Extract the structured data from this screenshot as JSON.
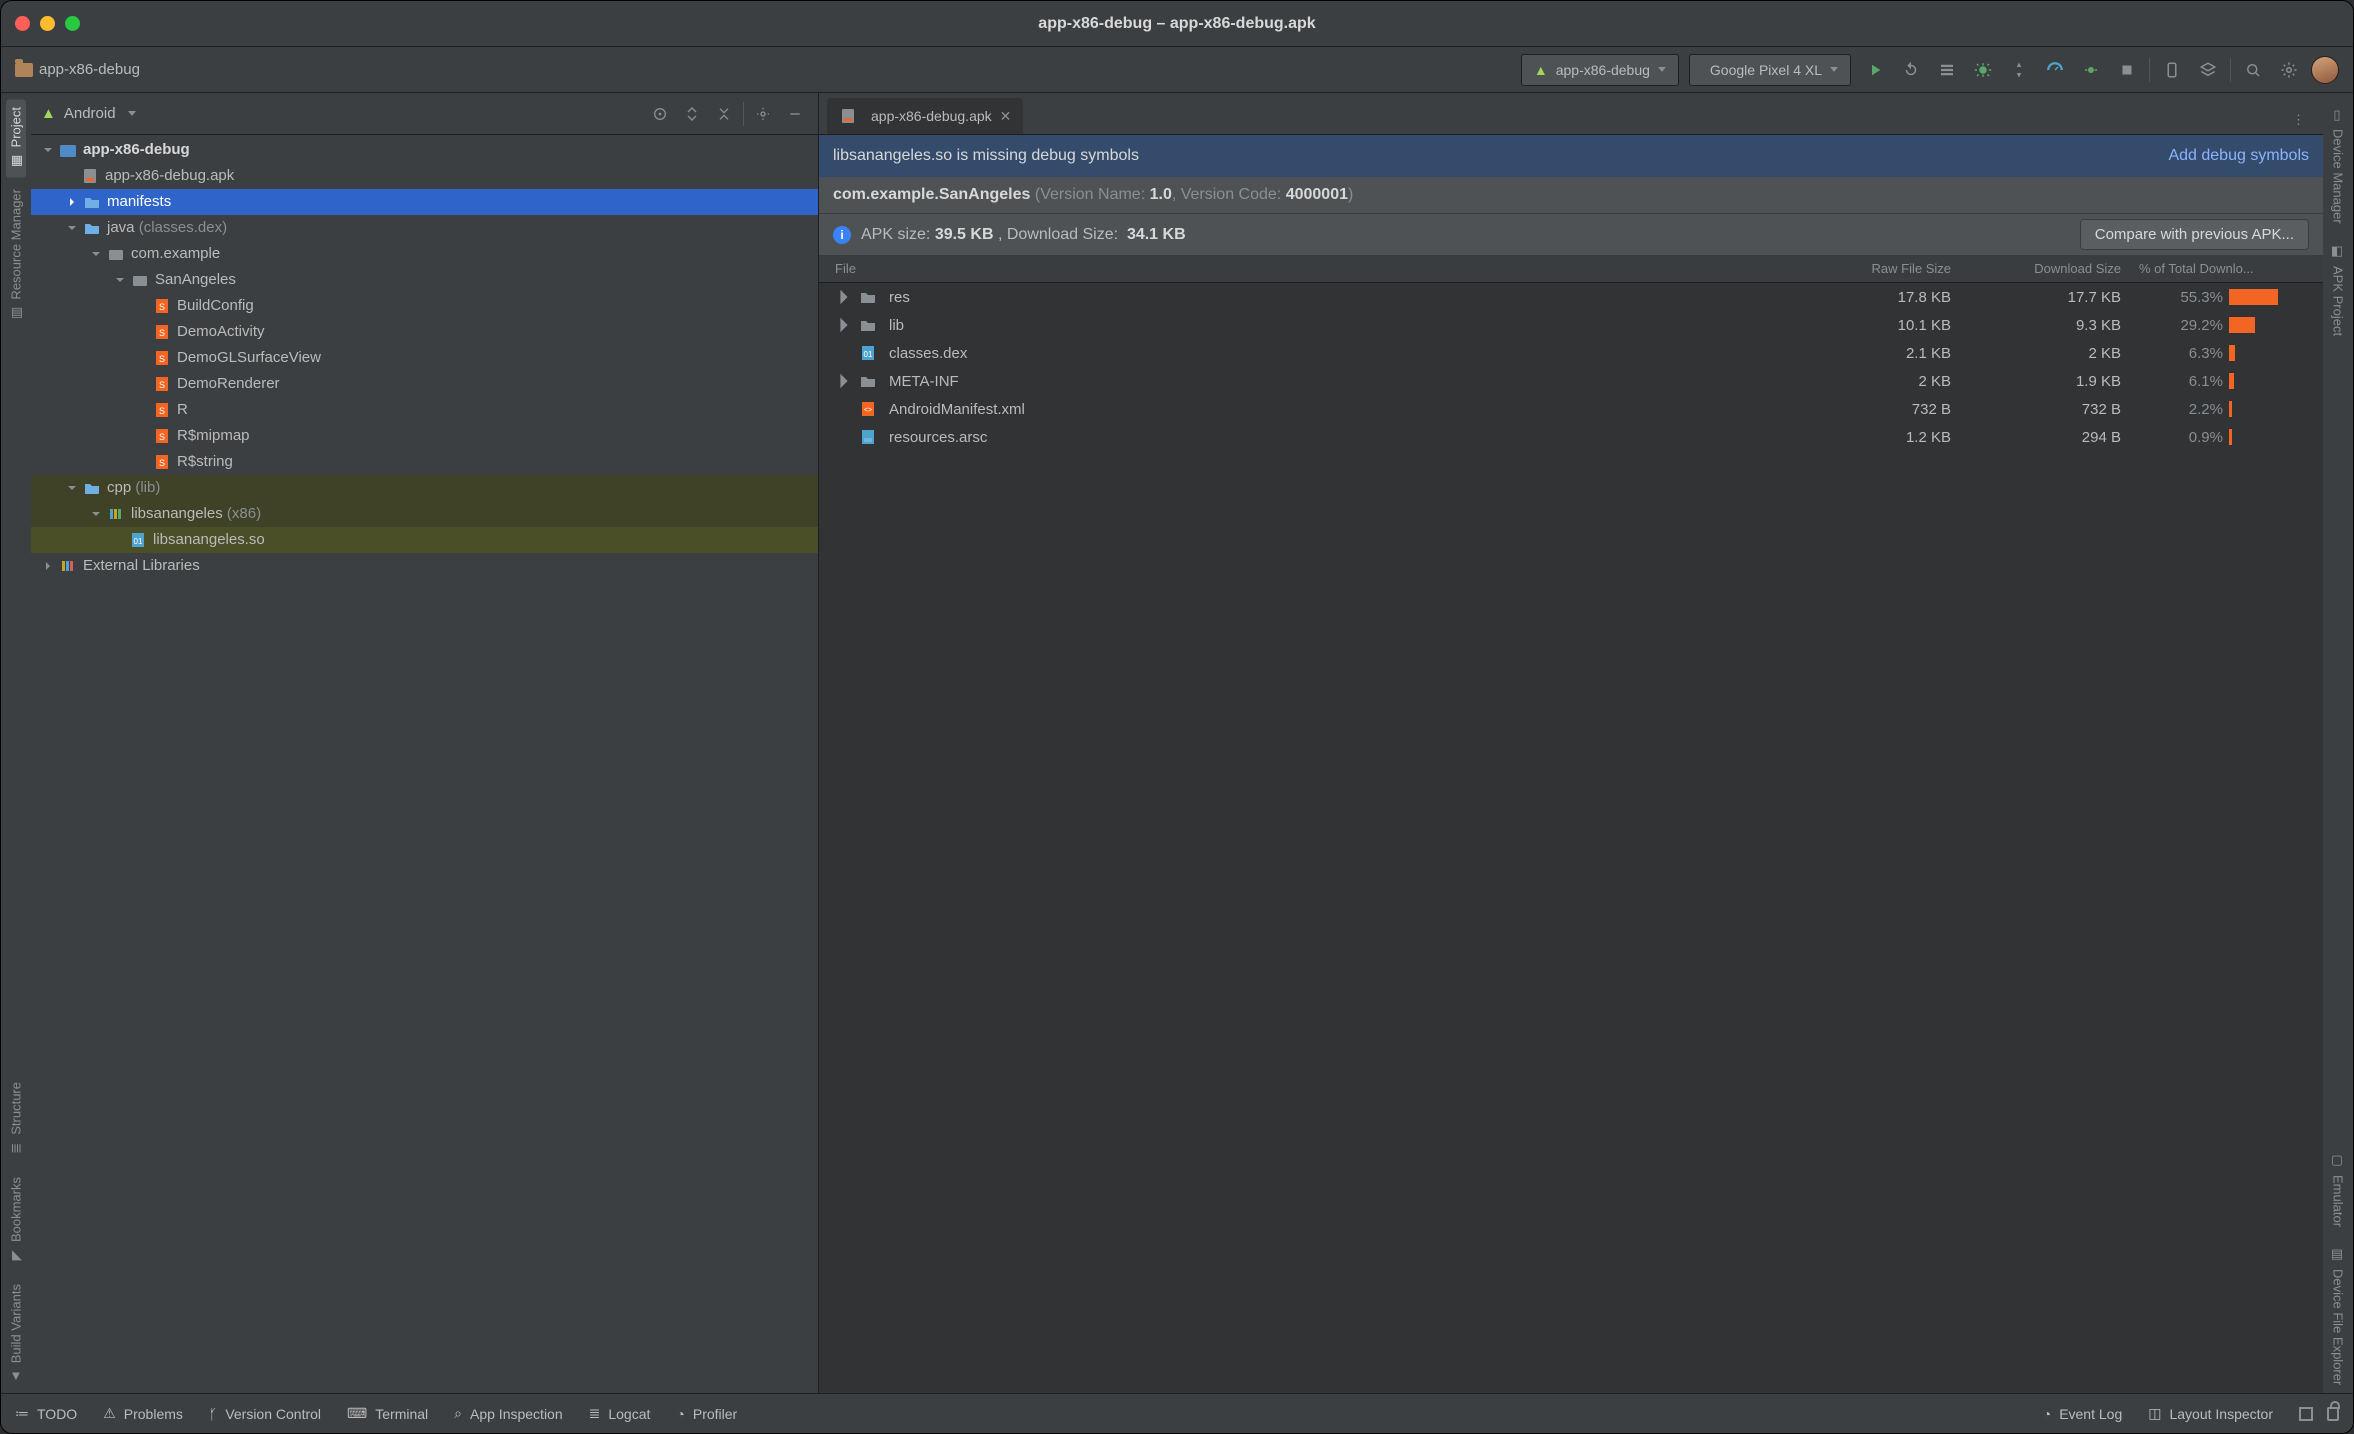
{
  "window": {
    "title": "app-x86-debug – app-x86-debug.apk"
  },
  "breadcrumb": {
    "root": "app-x86-debug"
  },
  "toolbar": {
    "run_config": "app-x86-debug",
    "device": "Google Pixel 4 XL"
  },
  "project_panel": {
    "view_selector": "Android",
    "tree": {
      "root": {
        "label": "app-x86-debug"
      },
      "apk": {
        "label": "app-x86-debug.apk"
      },
      "manifests": {
        "label": "manifests"
      },
      "java": {
        "label": "java",
        "note": "(classes.dex)"
      },
      "pkg1": {
        "label": "com.example"
      },
      "pkg2": {
        "label": "SanAngeles"
      },
      "cls_build": {
        "label": "BuildConfig"
      },
      "cls_demo": {
        "label": "DemoActivity"
      },
      "cls_glsv": {
        "label": "DemoGLSurfaceView"
      },
      "cls_render": {
        "label": "DemoRenderer"
      },
      "cls_r": {
        "label": "R"
      },
      "cls_rmip": {
        "label": "R$mipmap"
      },
      "cls_rstr": {
        "label": "R$string"
      },
      "cpp": {
        "label": "cpp",
        "note": "(lib)"
      },
      "lib1": {
        "label": "libsanangeles",
        "note": "(x86)"
      },
      "so": {
        "label": "libsanangeles.so"
      },
      "extlib": {
        "label": "External Libraries"
      }
    }
  },
  "left_strips": {
    "project": "Project",
    "res_mgr": "Resource Manager",
    "structure": "Structure",
    "bookmarks": "Bookmarks",
    "build_var": "Build Variants"
  },
  "right_strips": {
    "dev_mgr": "Device Manager",
    "apk_proj": "APK Project",
    "emulator": "Emulator",
    "dev_file": "Device File Explorer"
  },
  "editor": {
    "tab": "app-x86-debug.apk",
    "banner_msg": "libsanangeles.so is missing debug symbols",
    "banner_action": "Add debug symbols",
    "package": "com.example.SanAngeles",
    "version_name_label": "Version Name:",
    "version_name": "1.0",
    "version_code_label": "Version Code:",
    "version_code": "4000001",
    "apk_size_label": "APK size:",
    "apk_size": "39.5 KB",
    "download_size_label": ", Download Size:",
    "download_size": "34.1 KB",
    "compare_btn": "Compare with previous APK...",
    "table": {
      "headers": {
        "file": "File",
        "raw": "Raw File Size",
        "dl": "Download Size",
        "pct": "% of Total Downlo..."
      },
      "rows": [
        {
          "name": "res",
          "icon": "folder",
          "expand": true,
          "raw": "17.8 KB",
          "dl": "17.7 KB",
          "pct": "55.3%",
          "bar": 55.3
        },
        {
          "name": "lib",
          "icon": "folder",
          "expand": true,
          "raw": "10.1 KB",
          "dl": "9.3 KB",
          "pct": "29.2%",
          "bar": 29.2
        },
        {
          "name": "classes.dex",
          "icon": "dex",
          "expand": false,
          "raw": "2.1 KB",
          "dl": "2 KB",
          "pct": "6.3%",
          "bar": 6.3
        },
        {
          "name": "META-INF",
          "icon": "folder",
          "expand": true,
          "raw": "2 KB",
          "dl": "1.9 KB",
          "pct": "6.1%",
          "bar": 6.1
        },
        {
          "name": "AndroidManifest.xml",
          "icon": "xml",
          "expand": false,
          "raw": "732 B",
          "dl": "732 B",
          "pct": "2.2%",
          "bar": 2.2
        },
        {
          "name": "resources.arsc",
          "icon": "arsc",
          "expand": false,
          "raw": "1.2 KB",
          "dl": "294 B",
          "pct": "0.9%",
          "bar": 0.9
        }
      ]
    }
  },
  "statusbar": {
    "todo": "TODO",
    "problems": "Problems",
    "vcs": "Version Control",
    "terminal": "Terminal",
    "appinsp": "App Inspection",
    "logcat": "Logcat",
    "profiler": "Profiler",
    "eventlog": "Event Log",
    "layoutinsp": "Layout Inspector"
  }
}
